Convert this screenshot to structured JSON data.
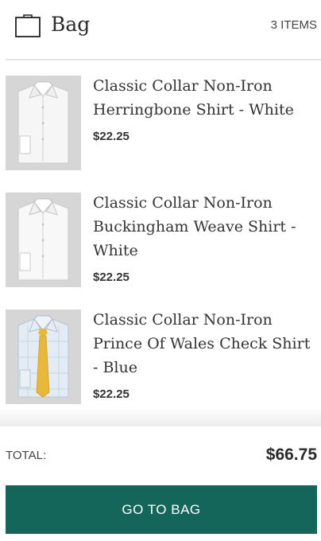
{
  "header": {
    "title": "Bag",
    "item_count": "3 ITEMS",
    "icon": "shopping-bag-icon"
  },
  "items": [
    {
      "name": "Classic Collar Non-Iron Herringbone Shirt - White",
      "price": "$22.25",
      "image": "white-shirt-thumbnail"
    },
    {
      "name": "Classic Collar Non-Iron Buckingham Weave Shirt - White",
      "price": "$22.25",
      "image": "white-shirt-thumbnail"
    },
    {
      "name": "Classic Collar Non-Iron Prince Of Wales Check Shirt - Blue",
      "price": "$22.25",
      "image": "blue-check-shirt-with-yellow-tie-thumbnail"
    }
  ],
  "summary": {
    "total_label": "TOTAL:",
    "total_value": "$66.75"
  },
  "actions": {
    "go_to_bag_label": "GO TO BAG"
  },
  "colors": {
    "accent": "#14665a",
    "text": "#333333",
    "thumb_bg": "#d9d9d9",
    "tie": "#e8b83a",
    "blue_shirt": "#dfe9f2"
  }
}
